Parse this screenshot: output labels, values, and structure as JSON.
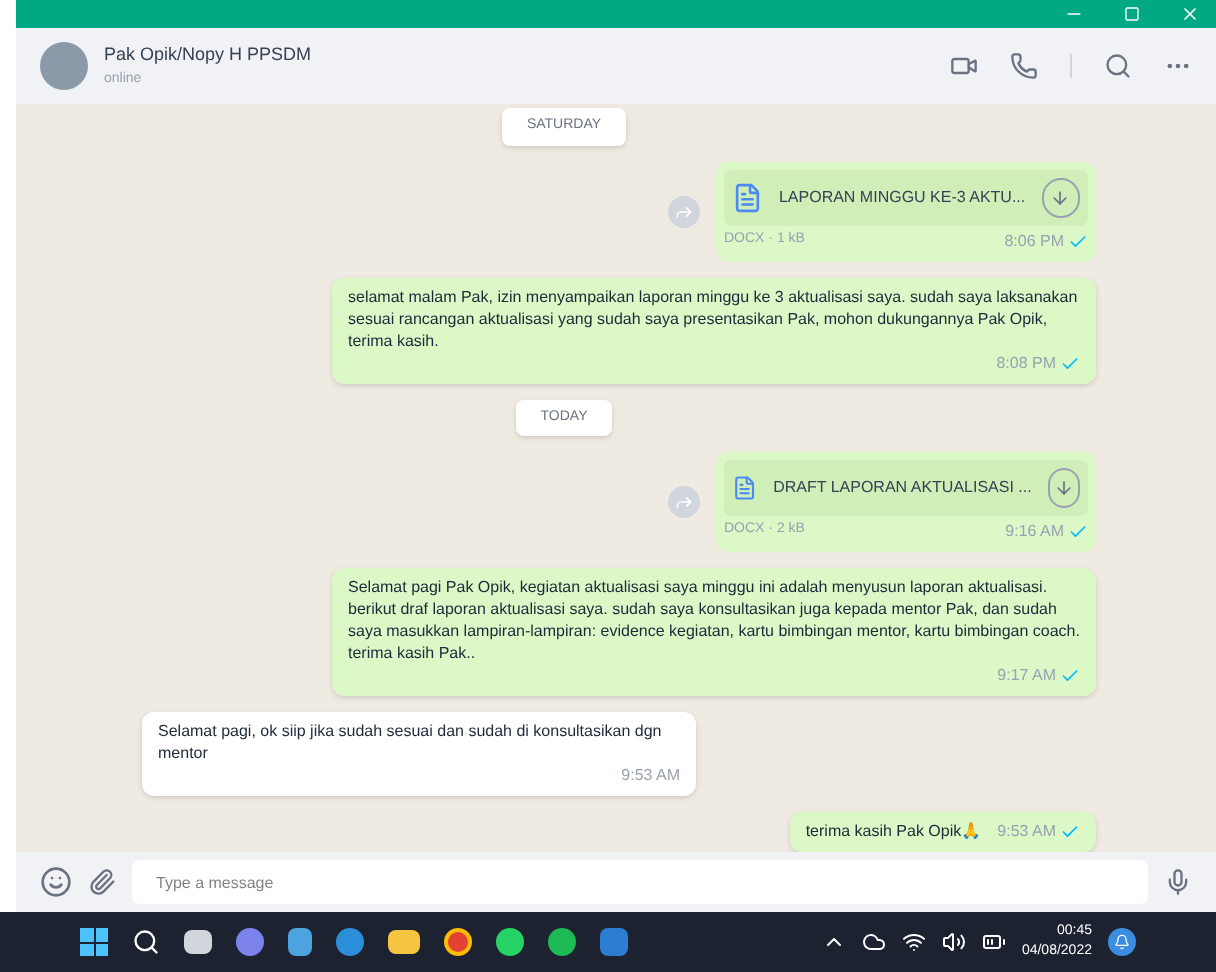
{
  "chat": {
    "name": "Pak Opik/Nopy H PPSDM",
    "status": "online"
  },
  "messages": [
    {
      "kind": "date",
      "text": "SATURDAY"
    },
    {
      "kind": "doc",
      "outgoing": true,
      "filename": "LAPORAN MINGGU KE-3 AKTU...",
      "meta": "DOCX · 1 kB",
      "time": "8:06 PM"
    },
    {
      "kind": "text",
      "outgoing": true,
      "text": "selamat malam Pak, izin menyampaikan laporan minggu ke 3 aktualisasi saya. sudah saya laksanakan sesuai rancangan aktualisasi yang sudah saya presentasikan Pak, mohon dukungannya Pak Opik, terima kasih.",
      "time": "8:08 PM"
    },
    {
      "kind": "date",
      "text": "TODAY"
    },
    {
      "kind": "doc",
      "outgoing": true,
      "filename": "DRAFT LAPORAN AKTUALISASI ...",
      "meta": "DOCX · 2 kB",
      "time": "9:16 AM"
    },
    {
      "kind": "text",
      "outgoing": true,
      "text": "Selamat pagi Pak Opik, kegiatan aktualisasi saya minggu ini adalah menyusun laporan aktualisasi. berikut draf laporan aktualisasi saya. sudah saya konsultasikan juga kepada mentor Pak, dan sudah saya masukkan lampiran-lampiran: evidence kegiatan, kartu bimbingan mentor, kartu bimbingan coach. terima kasih Pak..",
      "time": "9:17 AM"
    },
    {
      "kind": "text",
      "outgoing": false,
      "text": "Selamat pagi, ok siip jika sudah sesuai dan sudah di konsultasikan dgn mentor",
      "time": "9:53 AM"
    },
    {
      "kind": "text",
      "outgoing": true,
      "text": "terima kasih Pak Opik🙏",
      "time": "9:53 AM"
    }
  ],
  "composer": {
    "placeholder": "Type a message"
  },
  "taskbar": {
    "time": "00:45",
    "date": "04/08/2022"
  }
}
